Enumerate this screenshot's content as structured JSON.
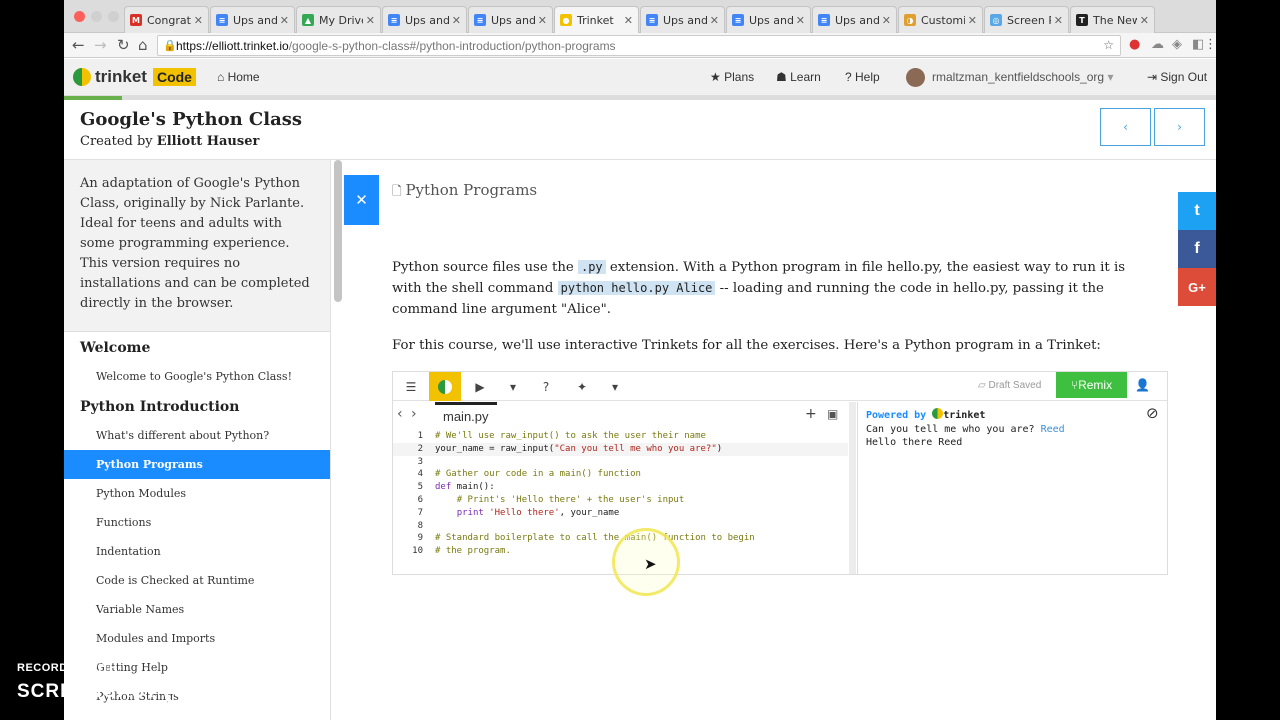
{
  "browser": {
    "tabs": [
      {
        "title": "Congrats",
        "fav": "M",
        "color": "#d93025"
      },
      {
        "title": "Ups and",
        "fav": "≡",
        "color": "#4285f4"
      },
      {
        "title": "My Drive",
        "fav": "▲",
        "color": "#34a853"
      },
      {
        "title": "Ups and",
        "fav": "≡",
        "color": "#4285f4"
      },
      {
        "title": "Ups and",
        "fav": "≡",
        "color": "#4285f4"
      },
      {
        "title": "Trinket",
        "fav": "●",
        "color": "#f2c200"
      },
      {
        "title": "Ups and",
        "fav": "≡",
        "color": "#4285f4"
      },
      {
        "title": "Ups and",
        "fav": "≡",
        "color": "#4285f4"
      },
      {
        "title": "Ups and",
        "fav": "≡",
        "color": "#4285f4"
      },
      {
        "title": "Customiz",
        "fav": "◑",
        "color": "#e0a030"
      },
      {
        "title": "Screen R",
        "fav": "◎",
        "color": "#5aa9e6"
      },
      {
        "title": "The New",
        "fav": "T",
        "color": "#222222"
      }
    ],
    "url_host": "https://elliott.trinket.io",
    "url_path": "/google-s-python-class#/python-introduction/python-programs"
  },
  "header": {
    "logo": "trinket",
    "badge": "Code",
    "home": "Home",
    "plans": "Plans",
    "learn": "Learn",
    "help": "Help",
    "user": "rmaltzman_kentfieldschools_org",
    "signout": "Sign Out",
    "progress": 0.05
  },
  "course": {
    "title": "Google's Python Class",
    "by_prefix": "Created by",
    "author": "Elliott Hauser",
    "prev": "‹",
    "next": "›"
  },
  "sidebar": {
    "description": "An adaptation of Google's Python Class, originally by Nick Parlante. Ideal for teens and adults with some programming experience. This version requires no installations and can be completed directly in the browser.",
    "sections": [
      {
        "title": "Welcome",
        "items": [
          {
            "label": "Welcome to Google's Python Class!",
            "active": false
          }
        ]
      },
      {
        "title": "Python Introduction",
        "items": [
          {
            "label": "What's different about Python?",
            "active": false
          },
          {
            "label": "Python Programs",
            "active": true
          },
          {
            "label": "Python Modules",
            "active": false
          },
          {
            "label": "Functions",
            "active": false
          },
          {
            "label": "Indentation",
            "active": false
          },
          {
            "label": "Code is Checked at Runtime",
            "active": false
          },
          {
            "label": "Variable Names",
            "active": false
          },
          {
            "label": "Modules and Imports",
            "active": false
          },
          {
            "label": "Getting Help",
            "active": false
          },
          {
            "label": "Python Strings",
            "active": false
          }
        ]
      }
    ]
  },
  "main": {
    "page_title": "Python Programs",
    "p1_a": "Python source files use the ",
    "p1_code1": ".py",
    "p1_b": " extension. With a Python program in file hello.py, the easiest way to run it is with the shell command ",
    "p1_code2": "python hello.py Alice",
    "p1_c": " -- loading and running the code in hello.py, passing it the command line argument \"Alice\".",
    "p2": "For this course, we'll use interactive Trinkets for all the exercises. Here's a Python program in a Trinket:"
  },
  "trinket": {
    "draft": "Draft Saved",
    "remix": "Remix",
    "file": "main.py",
    "code": [
      [
        [
          "cm",
          "# We'll use raw_input() to ask the user their name"
        ]
      ],
      [
        [
          "",
          "your_name = raw_input("
        ],
        [
          "st",
          "\"Can you tell me who you are?\""
        ],
        [
          "",
          ")"
        ]
      ],
      [],
      [
        [
          "cm",
          "# Gather our code in a main() function"
        ]
      ],
      [
        [
          "kw",
          "def"
        ],
        [
          "",
          " main():"
        ]
      ],
      [
        [
          "",
          "    "
        ],
        [
          "cm",
          "# Print's 'Hello there' + the user's input"
        ]
      ],
      [
        [
          "",
          "    "
        ],
        [
          "kw",
          "print"
        ],
        [
          "",
          " "
        ],
        [
          "st",
          "'Hello there'"
        ],
        [
          "",
          ", your_name"
        ]
      ],
      [],
      [
        [
          "cm",
          "# Standard boilerplate to call the main() function to begin"
        ]
      ],
      [
        [
          "cm",
          "# the program."
        ]
      ]
    ],
    "powered": "Powered by",
    "powered_brand": "trinket",
    "out_prompt": "Can you tell me who you are?",
    "out_input": "Reed",
    "out_line2": "Hello there Reed"
  },
  "social": {
    "twitter": "t",
    "facebook": "f",
    "gplus": "G+"
  },
  "watermark": {
    "line1": "RECORDED WITH",
    "line2a": "SCREENCAST",
    "line2b": "MATIC"
  }
}
